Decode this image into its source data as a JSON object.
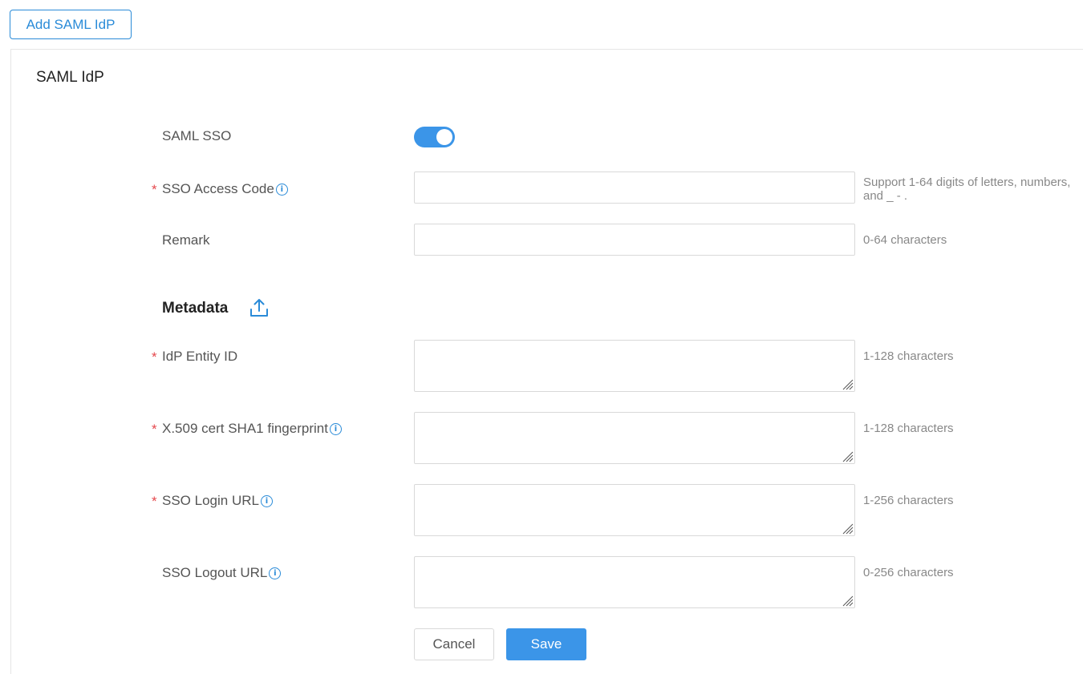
{
  "add_button": "Add SAML IdP",
  "panel_title": "SAML IdP",
  "fields": {
    "saml_sso": {
      "label": "SAML SSO",
      "enabled": true
    },
    "sso_access_code": {
      "label": "SSO Access Code",
      "required": "*",
      "value": "",
      "hint_line1": "Support 1-64 digits of letters, numbers,",
      "hint_line2": "and _ - ."
    },
    "remark": {
      "label": "Remark",
      "value": "",
      "hint": "0-64 characters"
    },
    "metadata_title": "Metadata",
    "idp_entity_id": {
      "label": "IdP Entity ID",
      "required": "*",
      "value": "",
      "hint": "1-128 characters"
    },
    "x509": {
      "label": "X.509 cert SHA1 fingerprint",
      "required": "*",
      "value": "",
      "hint": "1-128 characters"
    },
    "sso_login_url": {
      "label": "SSO Login URL",
      "required": "*",
      "value": "",
      "hint": "1-256 characters"
    },
    "sso_logout_url": {
      "label": "SSO Logout URL",
      "value": "",
      "hint": "0-256 characters"
    }
  },
  "info_glyph": "i",
  "buttons": {
    "cancel": "Cancel",
    "save": "Save"
  },
  "colors": {
    "accent": "#3b95e8",
    "link": "#2a8bd8",
    "required": "#e5484d"
  },
  "icons": {
    "upload": "upload-icon",
    "info": "info-icon"
  }
}
